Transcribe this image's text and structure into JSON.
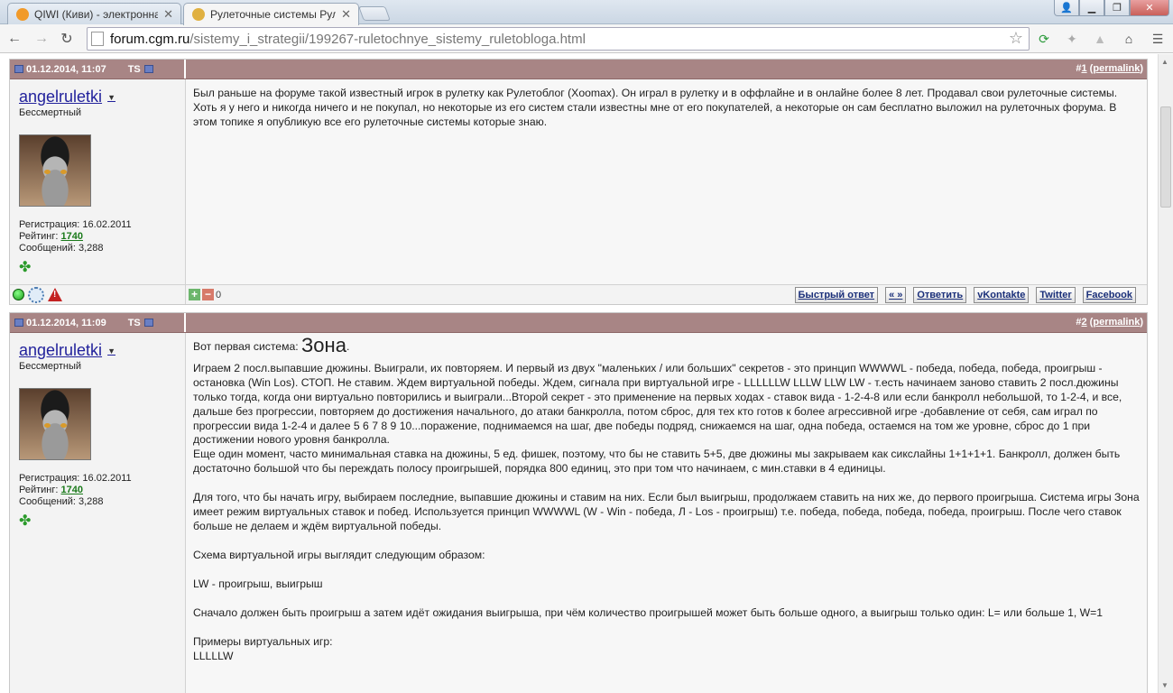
{
  "browser": {
    "tabs": [
      {
        "title": "QIWI (Киви) - электронна",
        "active": false,
        "favicon_color": "#f19a2a"
      },
      {
        "title": "Рулеточные системы Рул",
        "active": true,
        "favicon_color": "#e0b040"
      }
    ],
    "url_host": "forum.cgm.ru",
    "url_path": "/sistemy_i_strategii/199267-ruletochnye_sistemy_ruletobloga.html"
  },
  "posts": [
    {
      "date": "01.12.2014, 11:07",
      "ts_label": "TS",
      "number_prefix": "#",
      "number": "1",
      "permalink_label": "permalink",
      "username": "angelruletki",
      "rank": "Бессмертный",
      "reg_label": "Регистрация: ",
      "reg_date": "16.02.2011",
      "rating_label": "Рейтинг: ",
      "rating": "1740",
      "messages_label": "Сообщений: ",
      "messages": "3,288",
      "vote_count": "0",
      "paragraphs": [
        "Был раньше на форуме такой известный игрок в рулетку как Рулетоблог (Xoomax). Он играл в рулетку и в оффлайне и в онлайне более 8 лет. Продавал свои рулеточные системы. Хоть я у него и никогда ничего и не покупал, но некоторые из его систем стали известны мне от его покупателей, а некоторые он сам бесплатно выложил на рулеточных форума. В этом топике я опубликую все его рулеточные системы которые знаю."
      ]
    },
    {
      "date": "01.12.2014, 11:09",
      "ts_label": "TS",
      "number_prefix": "#",
      "number": "2",
      "permalink_label": "permalink",
      "username": "angelruletki",
      "rank": "Бессмертный",
      "reg_label": "Регистрация: ",
      "reg_date": "16.02.2011",
      "rating_label": "Рейтинг: ",
      "rating": "1740",
      "messages_label": "Сообщений: ",
      "messages": "3,288",
      "intro": "Вот первая система: ",
      "intro_big": "Зона",
      "intro_end": ".",
      "paragraphs": [
        "Играем 2 посл.выпавшие дюжины. Выиграли, их повторяем. И первый из двух \"маленьких / или больших\" секретов - это принцип WWWWL - победа, победа, победа, проигрыш - остановка (Win Los). СТОП. Не ставим. Ждем виртуальной победы. Ждем, сигнала при виртуальной игре - LLLLLLW LLLW LLW LW - т.есть начинаем заново ставить 2 посл.дюжины только тогда, когда они виртуально повторились и выиграли...Второй секрет - это применение на первых ходах - ставок вида - 1-2-4-8 или если банкролл небольшой, то 1-2-4, и все, дальше без прогрессии, повторяем до достижения начального, до атаки банкролла, потом сброс, для тех кто готов к более агрессивной игре -добавление от себя, сам играл по прогрессии вида 1-2-4 и далее 5 6 7 8 9 10...поражение, поднимаемся на шаг, две победы подряд, снижаемся на шаг, одна победа, остаемся на том же уровне, сброс до 1 при достижении нового уровня банкролла.",
        "Еще один момент, часто минимальная ставка на дюжины, 5 ед. фишек, поэтому, что бы не ставить 5+5, две дюжины мы закрываем как сикслайны 1+1+1+1. Банкролл, должен быть достаточно большой что бы переждать полосу проигрышей, порядка 800 единиц, это при том что начинаем, с мин.ставки в 4 единицы.",
        "",
        "Для того, что бы начать игру, выбираем последние, выпавшие дюжины и ставим на них. Если был выигрыш, продолжаем ставить на них же, до первого проигрыша. Система игры Зона имеет режим виртуальных ставок и побед. Используется принцип WWWWL (W - Win - победа, Л - Los - проигрыш) т.е. победа, победа, победа, победа, проигрыш. После чего ставок больше не делаем и ждём виртуальной победы.",
        "",
        "Схема виртуальной игры выглядит следующим образом:",
        "",
        "LW - проигрыш, выигрыш",
        "",
        "Сначало должен быть проигрыш а затем идёт ожидания выигрыша, при чём количество проигрышей может быть больше одного, а выигрыш только один: L= или больше 1, W=1",
        "",
        "Примеры виртуальных игр:",
        "LLLLLW"
      ]
    }
  ],
  "footer_buttons": [
    "Быстрый ответ",
    "« »",
    "Ответить",
    "vKontakte",
    "Twitter",
    "Facebook"
  ]
}
